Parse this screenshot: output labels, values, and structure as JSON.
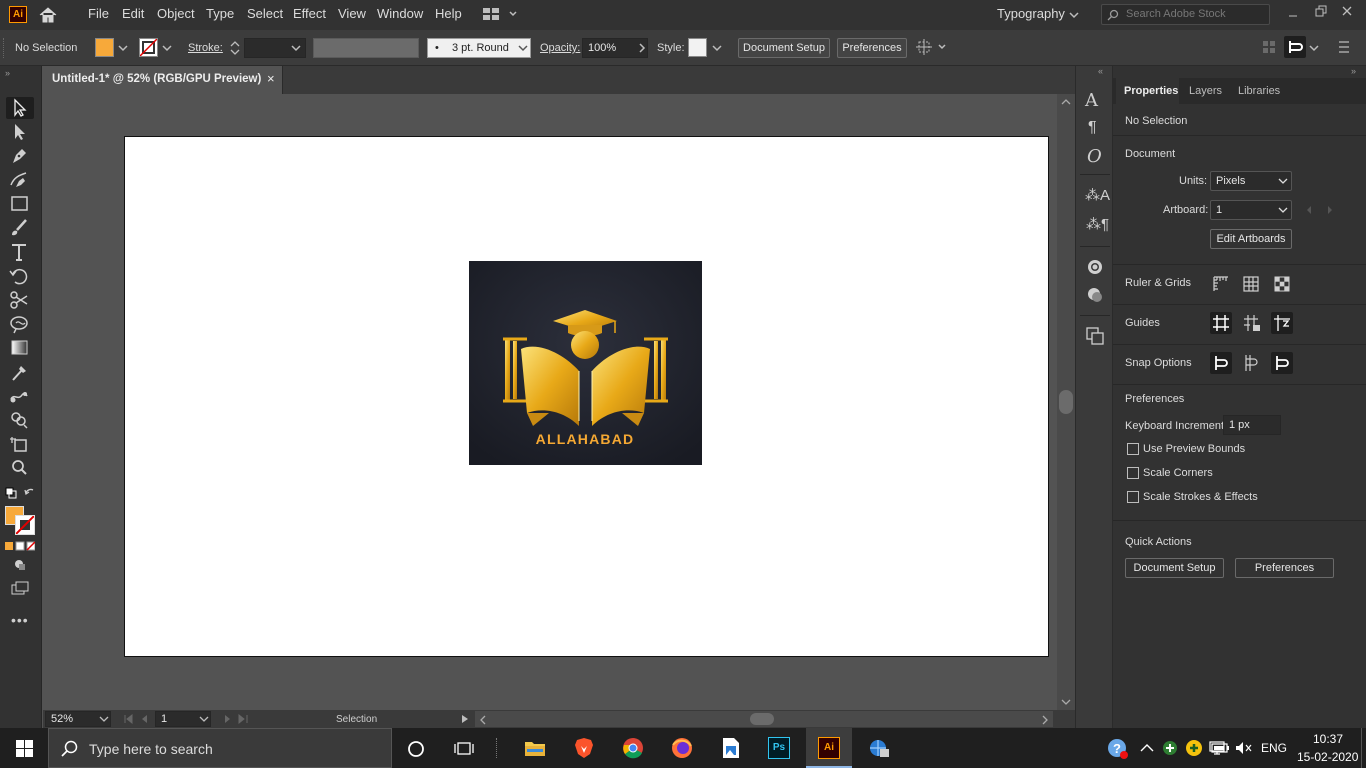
{
  "app": {
    "logo": "Ai"
  },
  "menu": {
    "items": [
      "File",
      "Edit",
      "Object",
      "Type",
      "Select",
      "Effect",
      "View",
      "Window",
      "Help"
    ],
    "workspace": "Typography",
    "search_placeholder": "Search Adobe Stock"
  },
  "control": {
    "selection": "No Selection",
    "fill_color": "#f7a93a",
    "stroke_label": "Stroke:",
    "brush": "3 pt. Round",
    "opacity_label": "Opacity:",
    "opacity_value": "100%",
    "style_label": "Style:",
    "document_setup": "Document Setup",
    "preferences": "Preferences"
  },
  "document": {
    "tab_title": "Untitled-1* @ 52% (RGB/GPU Preview)",
    "close": "×",
    "logo_text": "ALLAHABAD"
  },
  "status": {
    "zoom": "52%",
    "artboard": "1",
    "tool": "Selection"
  },
  "properties": {
    "tabs": [
      "Properties",
      "Layers",
      "Libraries"
    ],
    "selection": "No Selection",
    "document_heading": "Document",
    "units_label": "Units:",
    "units_value": "Pixels",
    "artboard_label": "Artboard:",
    "artboard_value": "1",
    "edit_artboards": "Edit Artboards",
    "ruler_grids": "Ruler & Grids",
    "guides": "Guides",
    "snap_options": "Snap Options",
    "preferences_heading": "Preferences",
    "keyboard_increment_label": "Keyboard Increment:",
    "keyboard_increment_value": "1 px",
    "checkboxes": [
      "Use Preview Bounds",
      "Scale Corners",
      "Scale Strokes & Effects"
    ],
    "quick_actions": "Quick Actions",
    "document_setup": "Document Setup",
    "preferences": "Preferences"
  },
  "taskbar": {
    "search_placeholder": "Type here to search",
    "language": "ENG",
    "time": "10:37",
    "date": "15-02-2020"
  }
}
